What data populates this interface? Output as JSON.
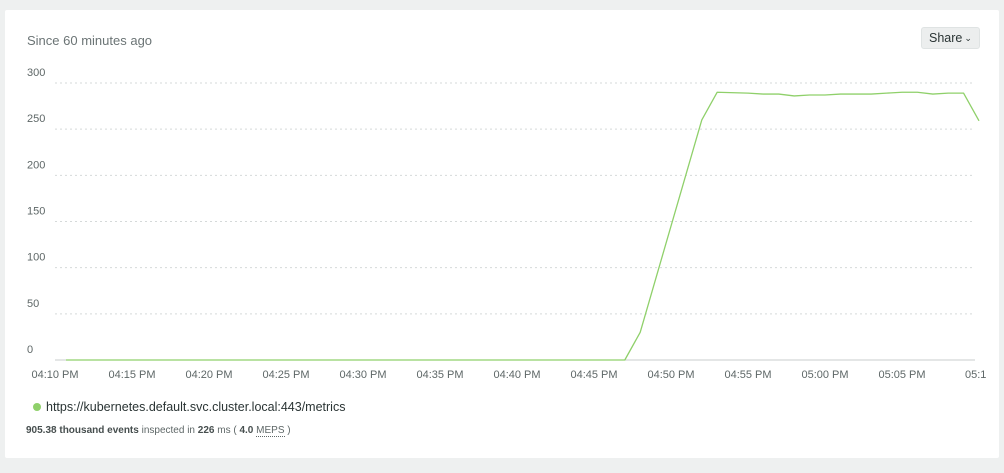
{
  "header": {
    "since_label": "Since 60 minutes ago",
    "share_label": "Share"
  },
  "colors": {
    "series": "#8fd06a",
    "grid": "#d5d9d9"
  },
  "chart_data": {
    "type": "line",
    "ylim": [
      0,
      300
    ],
    "y_ticks": [
      "0",
      "50",
      "100",
      "150",
      "200",
      "250",
      "300"
    ],
    "x_ticks": [
      "04:10 PM",
      "04:15 PM",
      "04:20 PM",
      "04:25 PM",
      "04:30 PM",
      "04:35 PM",
      "04:40 PM",
      "04:45 PM",
      "04:50 PM",
      "04:55 PM",
      "05:00 PM",
      "05:05 PM",
      "05:1"
    ],
    "grid": true,
    "legend_position": "bottom-left",
    "series": [
      {
        "name": "https://kubernetes.default.svc.cluster.local:443/metrics",
        "x": [
          "04:10 PM",
          "04:47 PM",
          "04:48 PM",
          "04:52 PM",
          "04:53 PM",
          "04:55 PM",
          "04:56 PM",
          "04:57 PM",
          "04:58 PM",
          "04:59 PM",
          "05:00 PM",
          "05:01 PM",
          "05:02 PM",
          "05:03 PM",
          "05:04 PM",
          "05:05 PM",
          "05:06 PM",
          "05:07 PM",
          "05:08 PM",
          "05:09 PM",
          "05:10 PM"
        ],
        "values": [
          0,
          0,
          30,
          260,
          290,
          289,
          288,
          288,
          286,
          287,
          287,
          288,
          288,
          288,
          289,
          290,
          290,
          288,
          289,
          289,
          259
        ]
      }
    ]
  },
  "legend": {
    "series_label": "https://kubernetes.default.svc.cluster.local:443/metrics"
  },
  "footer": {
    "events_count": "905.38 thousand events",
    "inspected_in": "inspected in",
    "duration": "226",
    "ms_paren": "ms (",
    "meps_value": "4.0",
    "meps_label": "MEPS",
    "close_paren": ")"
  }
}
